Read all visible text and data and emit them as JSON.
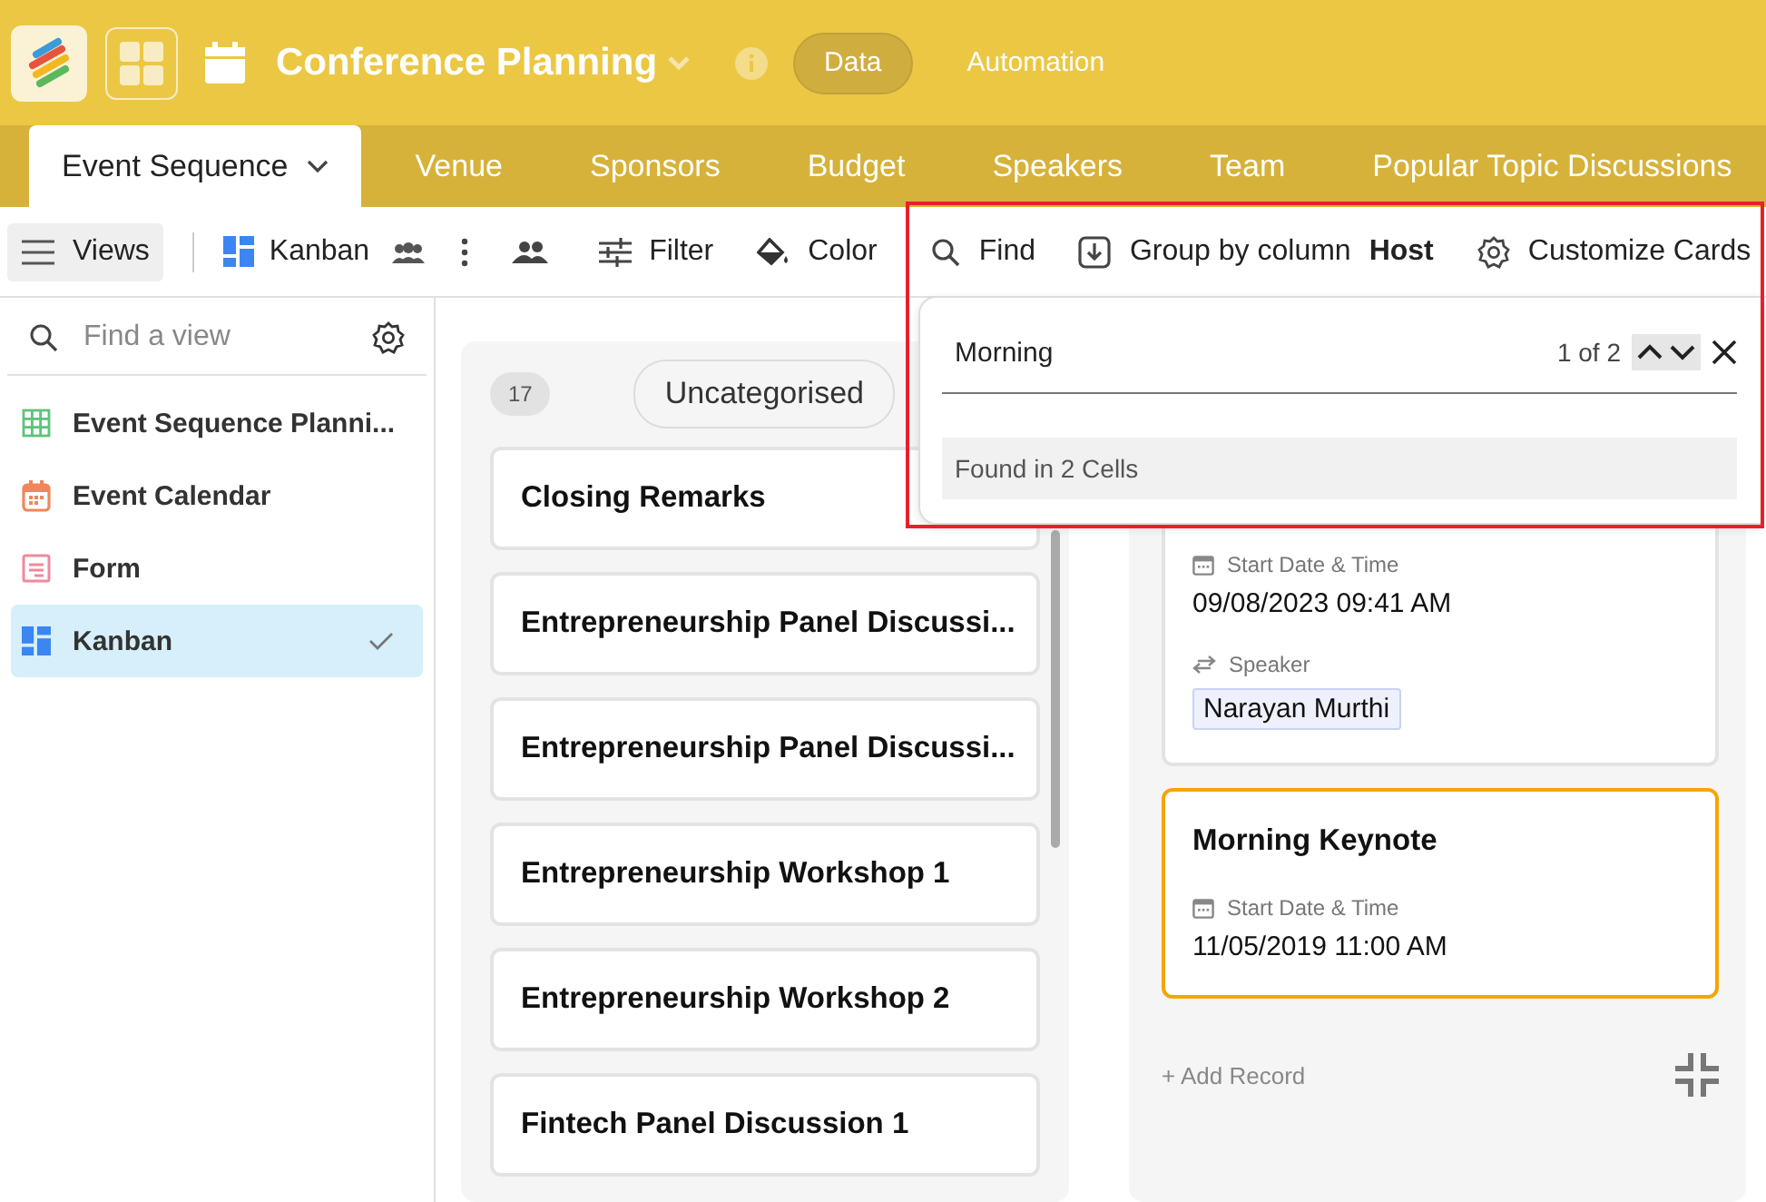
{
  "header": {
    "title": "Conference Planning",
    "nav": [
      {
        "label": "Data",
        "selected": true
      },
      {
        "label": "Automation",
        "selected": false
      }
    ]
  },
  "tabs": [
    {
      "label": "Event Sequence",
      "selected": true
    },
    {
      "label": "Venue",
      "selected": false
    },
    {
      "label": "Sponsors",
      "selected": false
    },
    {
      "label": "Budget",
      "selected": false
    },
    {
      "label": "Speakers",
      "selected": false
    },
    {
      "label": "Team",
      "selected": false
    },
    {
      "label": "Popular Topic Discussions",
      "selected": false
    }
  ],
  "toolbar": {
    "views": "Views",
    "view_name": "Kanban",
    "filter": "Filter",
    "paint": "Color",
    "find": "Find",
    "group_by": "Group by column **Host**",
    "customize": "Customize Cards"
  },
  "sidebar": {
    "search_placeholder": "Find a view",
    "views": [
      {
        "label": "Event Sequence Planni...",
        "kind": "grid",
        "selected": false
      },
      {
        "label": "Event Calendar",
        "kind": "calendar",
        "selected": false
      },
      {
        "label": "Form",
        "kind": "form",
        "selected": false
      },
      {
        "label": "Kanban",
        "kind": "kanban",
        "selected": true
      }
    ]
  },
  "find_popup": {
    "query": "Morning",
    "match_count": "1 of 2",
    "result": "Found in 2 Cells"
  },
  "columns": [
    {
      "count": "17",
      "title": "Uncategorised",
      "cards": [
        {
          "title": "Closing Remarks",
          "highlighted": false
        },
        {
          "title": "Entrepreneurship Panel Discussi...",
          "highlighted": false
        },
        {
          "title": "Entrepreneurship Panel Discussi...",
          "highlighted": false
        },
        {
          "title": "Entrepreneurship Workshop 1",
          "highlighted": false
        },
        {
          "title": "Entrepreneurship Workshop 2",
          "highlighted": false
        },
        {
          "title": "Fintech Panel Discussion 1",
          "highlighted": false
        }
      ]
    },
    {
      "add_record": "+ Add Record",
      "cards": [
        {
          "highlighted": false,
          "fields": [
            {
              "kind": "date",
              "label": "Start Date & Time",
              "value": "09/08/2023 09:41 AM"
            },
            {
              "kind": "link",
              "label": "Speaker",
              "value": "Narayan Murthi"
            }
          ]
        },
        {
          "title": "Morning Keynote",
          "highlighted": true,
          "fields": [
            {
              "kind": "date",
              "label": "Start Date & Time",
              "value": "11/05/2019 11:00 AM"
            }
          ]
        }
      ]
    }
  ]
}
